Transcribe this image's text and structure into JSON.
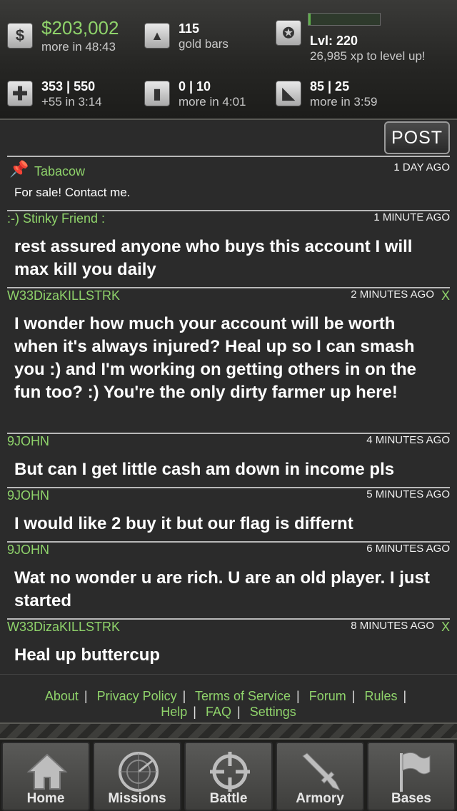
{
  "stats": {
    "cash": {
      "icon": "dollar-icon",
      "value": "$203,002",
      "sub": "more in 48:43"
    },
    "gold": {
      "icon": "gold-bar-icon",
      "value": "115",
      "sub": "gold bars"
    },
    "level": {
      "icon": "level-emblem-icon",
      "value": "Lvl: 220",
      "sub": "26,985 xp to level up!",
      "xp_progress": 0.03
    },
    "health": {
      "icon": "medic-cross-icon",
      "value": "353 | 550",
      "sub": "+55 in 3:14"
    },
    "energy": {
      "icon": "canister-icon",
      "value": "0 | 10",
      "sub": "more in 4:01"
    },
    "stamina": {
      "icon": "ammo-icon",
      "value": "85 | 25",
      "sub": "more in 3:59"
    }
  },
  "post_button": "POST",
  "posts": [
    {
      "author": "Tabacow",
      "time": "1 DAY AGO",
      "message": "For sale! Contact me.",
      "pinned": true,
      "deletable": false
    },
    {
      "author": ":-) Stinky Friend :",
      "time": "1 MINUTE AGO",
      "message": "rest assured anyone who buys this account I will max kill you daily",
      "pinned": false,
      "deletable": false
    },
    {
      "author": "W33DizaKILLSTRK",
      "time": "2 MINUTES AGO",
      "message": "I wonder how much your account will be worth when it's always injured? Heal up so I can smash you :) and I'm working on getting others in on the fun too? :) You're the only dirty farmer up here!",
      "pinned": false,
      "deletable": true
    },
    {
      "author": "9JOHN",
      "time": "4 MINUTES AGO",
      "message": "But can I get little cash am down in income pls",
      "pinned": false,
      "deletable": false
    },
    {
      "author": "9JOHN",
      "time": "5 MINUTES AGO",
      "message": "I would like 2 buy it but our flag is differnt",
      "pinned": false,
      "deletable": false
    },
    {
      "author": "9JOHN",
      "time": "6 MINUTES AGO",
      "message": "Wat no wonder u are rich. U are an old player. I just started",
      "pinned": false,
      "deletable": false
    },
    {
      "author": "W33DizaKILLSTRK",
      "time": "8 MINUTES AGO",
      "message": "Heal up buttercup",
      "pinned": false,
      "deletable": true
    }
  ],
  "delete_label": "X",
  "footer_links": [
    "About",
    "Privacy Policy",
    "Terms of Service",
    "Forum",
    "Rules",
    "Help",
    "FAQ",
    "Settings"
  ],
  "tabs": [
    {
      "label": "Home",
      "icon": "house-icon"
    },
    {
      "label": "Missions",
      "icon": "radar-icon"
    },
    {
      "label": "Battle",
      "icon": "crosshair-icon"
    },
    {
      "label": "Armory",
      "icon": "rifle-icon"
    },
    {
      "label": "Bases",
      "icon": "flag-icon"
    }
  ],
  "colors": {
    "accent_green": "#8fd36b",
    "background": "#2b2b2b",
    "rule": "#b9b9b9"
  }
}
